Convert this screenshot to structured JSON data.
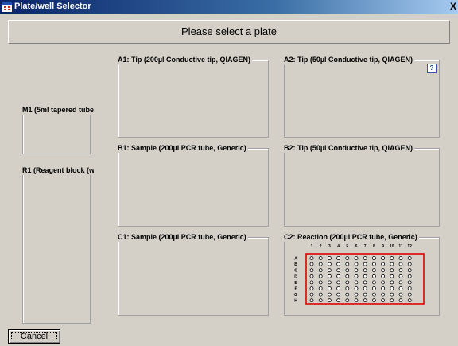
{
  "window": {
    "title": "Plate/well Selector",
    "close_glyph": "X"
  },
  "header": {
    "prompt": "Please select a plate"
  },
  "slots": {
    "M1": {
      "label": "M1 (5ml tapered tube"
    },
    "R1": {
      "label": "R1 (Reagent block (w"
    },
    "A1": {
      "label": "A1: Tip (200µl Conductive tip, QIAGEN)"
    },
    "A2": {
      "label": "A2: Tip (50µl Conductive tip, QIAGEN)",
      "help_glyph": "?"
    },
    "B1": {
      "label": "B1: Sample (200µl PCR tube, Generic)"
    },
    "B2": {
      "label": "B2: Tip (50µl Conductive tip, QIAGEN)"
    },
    "C1": {
      "label": "C1: Sample (200µl PCR tube, Generic)"
    },
    "C2": {
      "label": "C2: Reaction (200µl PCR tube, Generic)",
      "plate": {
        "columns": [
          "1",
          "2",
          "3",
          "4",
          "5",
          "6",
          "7",
          "8",
          "9",
          "10",
          "11",
          "12"
        ],
        "rows": [
          "A",
          "B",
          "C",
          "D",
          "E",
          "F",
          "G",
          "H"
        ],
        "selection_color": "#e00000"
      }
    }
  },
  "buttons": {
    "cancel": {
      "accel": "C",
      "rest": "ancel"
    }
  },
  "icons": {
    "app": "app-window-icon",
    "help": "help-icon"
  }
}
